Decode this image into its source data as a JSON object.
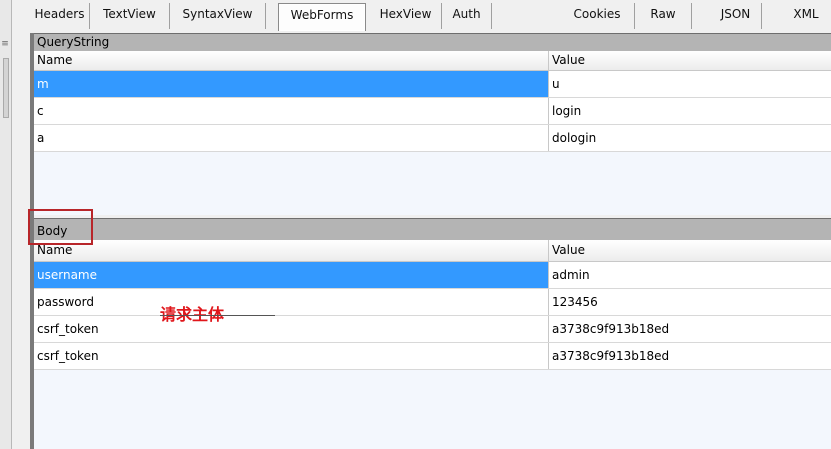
{
  "tabs": [
    "Headers",
    "TextView",
    "SyntaxView",
    "WebForms",
    "HexView",
    "Auth",
    "Cookies",
    "Raw",
    "JSON",
    "XML"
  ],
  "active_tab": "WebForms",
  "querystring": {
    "title": "QueryString",
    "columns": [
      "Name",
      "Value"
    ],
    "rows": [
      {
        "name": "m",
        "value": "u"
      },
      {
        "name": "c",
        "value": "login"
      },
      {
        "name": "a",
        "value": "dologin"
      }
    ],
    "selected_row": 0
  },
  "body_section": {
    "title": "Body",
    "columns": [
      "Name",
      "Value"
    ],
    "rows": [
      {
        "name": "username",
        "value": "admin"
      },
      {
        "name": "password",
        "value": "123456"
      },
      {
        "name": "csrf_token",
        "value": "a3738c9f913b18ed"
      },
      {
        "name": "csrf_token",
        "value": "a3738c9f913b18ed"
      }
    ],
    "selected_row": 0
  },
  "annotation": {
    "text": "请求主体",
    "color": "#e0161b",
    "box_color": "#b8262a"
  },
  "colors": {
    "selection": "#3399ff",
    "section_header": "#b4b4b4",
    "grid_background": "#f3f7fd"
  },
  "icons": {
    "grip": "grip-icon"
  }
}
